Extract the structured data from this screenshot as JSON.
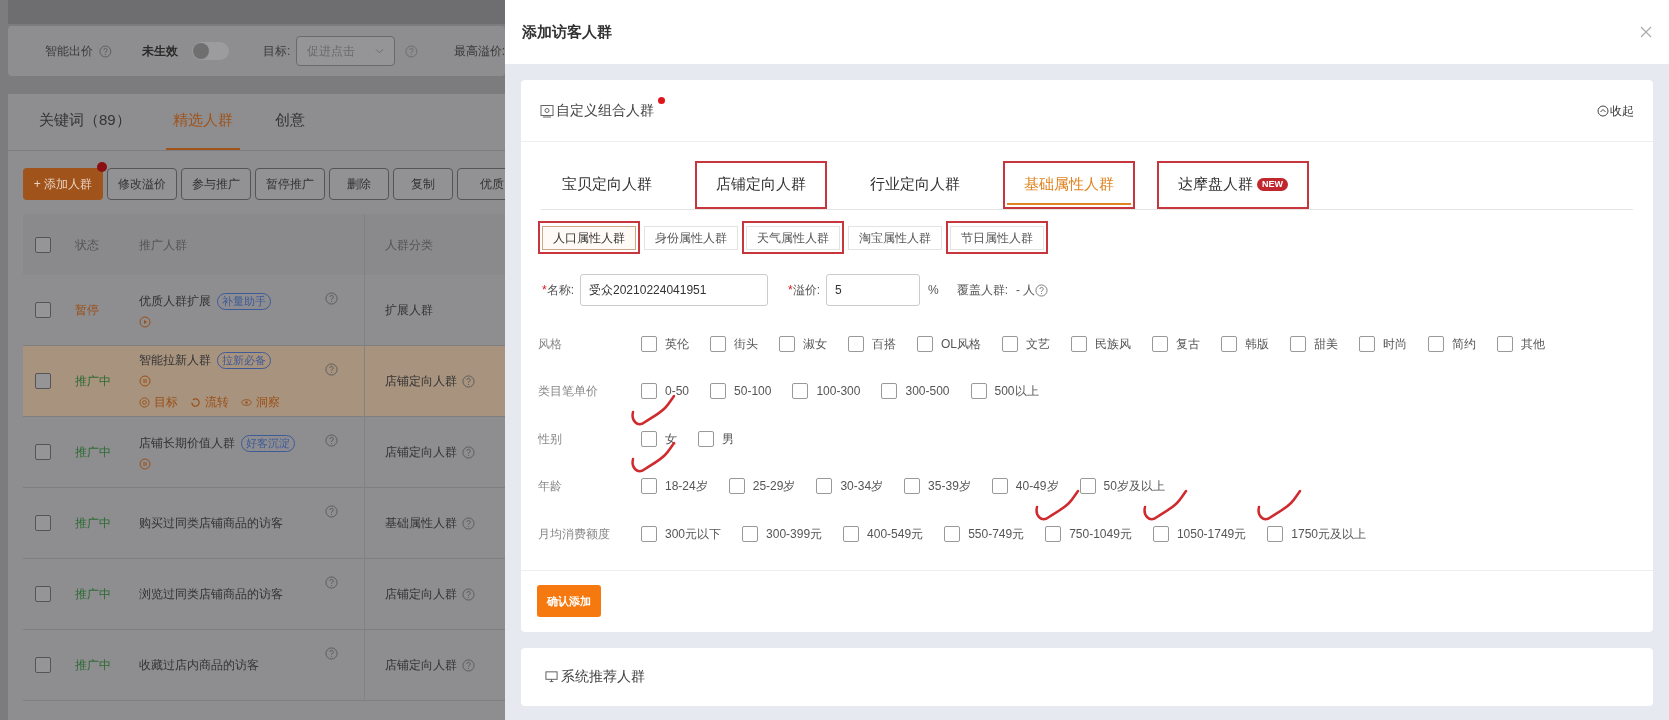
{
  "background_page": {
    "filter_bar": {
      "smart_bid_label": "智能出价",
      "toggle_label": "未生效",
      "toggle_on": false,
      "goal_label": "目标:",
      "goal_value": "促进点击",
      "max_premium_label": "最高溢价:"
    },
    "tabs": [
      {
        "label": "关键词（89）",
        "selected": false
      },
      {
        "label": "精选人群",
        "selected": true
      },
      {
        "label": "创意",
        "selected": false
      }
    ],
    "add_button": {
      "label": "+ 添加人群",
      "notify_dot": true
    },
    "toolbar_buttons": [
      "修改溢价",
      "参与推广",
      "暂停推广",
      "删除",
      "复制",
      "优质"
    ],
    "table": {
      "columns": [
        "状态",
        "推广人群",
        "人群分类"
      ],
      "header_checked": false,
      "rows": [
        {
          "checked": false,
          "status": "暂停",
          "kind": "paused",
          "name": "优质人群扩展",
          "tag": "补量助手",
          "status_control": true,
          "links": [],
          "category": "扩展人群",
          "category_help": false,
          "highlighted": false
        },
        {
          "checked": false,
          "status": "推广中",
          "kind": "active",
          "name": "智能拉新人群",
          "tag": "拉新必备",
          "status_control": true,
          "links": [
            "目标",
            "流转",
            "洞察"
          ],
          "category": "店铺定向人群",
          "category_help": true,
          "highlighted": true
        },
        {
          "checked": false,
          "status": "推广中",
          "kind": "active",
          "name": "店铺长期价值人群",
          "tag": "好客沉淀",
          "status_control": true,
          "links": [],
          "category": "店铺定向人群",
          "category_help": true,
          "highlighted": false
        },
        {
          "checked": false,
          "status": "推广中",
          "kind": "active",
          "name": "购买过同类店铺商品的访客",
          "category": "基础属性人群",
          "category_help": true,
          "highlighted": false
        },
        {
          "checked": false,
          "status": "推广中",
          "kind": "active",
          "name": "浏览过同类店铺商品的访客",
          "category": "店铺定向人群",
          "category_help": true,
          "highlighted": false
        },
        {
          "checked": false,
          "status": "推广中",
          "kind": "active",
          "name": "收藏过店内商品的访客",
          "category": "店铺定向人群",
          "category_help": true,
          "highlighted": false
        }
      ]
    }
  },
  "dialog": {
    "title": "添加访客人群",
    "custom_card": {
      "title": "自定义组合人群",
      "notify_dot": true,
      "collapse": "收起",
      "tabs": [
        {
          "label": "宝贝定向人群",
          "selected": false,
          "annotated": false
        },
        {
          "label": "店铺定向人群",
          "selected": false,
          "annotated": true
        },
        {
          "label": "行业定向人群",
          "selected": false,
          "annotated": false
        },
        {
          "label": "基础属性人群",
          "selected": true,
          "annotated": true
        },
        {
          "label": "达摩盘人群",
          "badge": "NEW",
          "selected": false,
          "annotated": true
        }
      ],
      "subtabs": [
        {
          "label": "人口属性人群",
          "selected": true,
          "annotated": true
        },
        {
          "label": "身份属性人群",
          "selected": false,
          "annotated": false
        },
        {
          "label": "天气属性人群",
          "selected": false,
          "annotated": true
        },
        {
          "label": "淘宝属性人群",
          "selected": false,
          "annotated": false
        },
        {
          "label": "节日属性人群",
          "selected": false,
          "annotated": true
        }
      ],
      "fields": [
        {
          "mark": "*",
          "label": "名称:",
          "value": "受众20210224041951"
        },
        {
          "mark": "*",
          "label": "溢价:",
          "value": "5",
          "suffix": "%"
        }
      ],
      "coverage_label": "覆盖人群:",
      "coverage_value": "- 人",
      "groups": [
        {
          "label": "风格",
          "options": [
            {
              "label": "英伦",
              "checked": false,
              "annotated": false
            },
            {
              "label": "街头",
              "checked": false,
              "annotated": false
            },
            {
              "label": "淑女",
              "checked": false,
              "annotated": false
            },
            {
              "label": "百搭",
              "checked": false,
              "annotated": false
            },
            {
              "label": "OL风格",
              "checked": false,
              "annotated": false
            },
            {
              "label": "文艺",
              "checked": false,
              "annotated": false
            },
            {
              "label": "民族风",
              "checked": false,
              "annotated": false
            },
            {
              "label": "复古",
              "checked": false,
              "annotated": false
            },
            {
              "label": "韩版",
              "checked": false,
              "annotated": false
            },
            {
              "label": "甜美",
              "checked": false,
              "annotated": false
            },
            {
              "label": "时尚",
              "checked": false,
              "annotated": false
            },
            {
              "label": "简约",
              "checked": false,
              "annotated": false
            },
            {
              "label": "其他",
              "checked": false,
              "annotated": false
            }
          ]
        },
        {
          "label": "类目笔单价",
          "options": [
            {
              "label": "0-50",
              "checked": false,
              "annotated": false
            },
            {
              "label": "50-100",
              "checked": false,
              "annotated": false
            },
            {
              "label": "100-300",
              "checked": false,
              "annotated": false
            },
            {
              "label": "300-500",
              "checked": false,
              "annotated": false
            },
            {
              "label": "500以上",
              "checked": false,
              "annotated": false
            }
          ]
        },
        {
          "label": "性别",
          "options": [
            {
              "label": "女",
              "checked": false,
              "annotated": true
            },
            {
              "label": "男",
              "checked": false,
              "annotated": false
            }
          ]
        },
        {
          "label": "年龄",
          "options": [
            {
              "label": "18-24岁",
              "checked": false,
              "annotated": true
            },
            {
              "label": "25-29岁",
              "checked": false,
              "annotated": false
            },
            {
              "label": "30-34岁",
              "checked": false,
              "annotated": false
            },
            {
              "label": "35-39岁",
              "checked": false,
              "annotated": false
            },
            {
              "label": "40-49岁",
              "checked": false,
              "annotated": false
            },
            {
              "label": "50岁及以上",
              "checked": false,
              "annotated": false
            }
          ]
        },
        {
          "label": "月均消费额度",
          "options": [
            {
              "label": "300元以下",
              "checked": false,
              "annotated": false
            },
            {
              "label": "300-399元",
              "checked": false,
              "annotated": false
            },
            {
              "label": "400-549元",
              "checked": false,
              "annotated": false
            },
            {
              "label": "550-749元",
              "checked": false,
              "annotated": false
            },
            {
              "label": "750-1049元",
              "checked": false,
              "annotated": true
            },
            {
              "label": "1050-1749元",
              "checked": false,
              "annotated": true
            },
            {
              "label": "1750元及以上",
              "checked": false,
              "annotated": true
            }
          ]
        }
      ],
      "confirm_button": "确认添加"
    },
    "system_card": {
      "title": "系统推荐人群"
    }
  }
}
